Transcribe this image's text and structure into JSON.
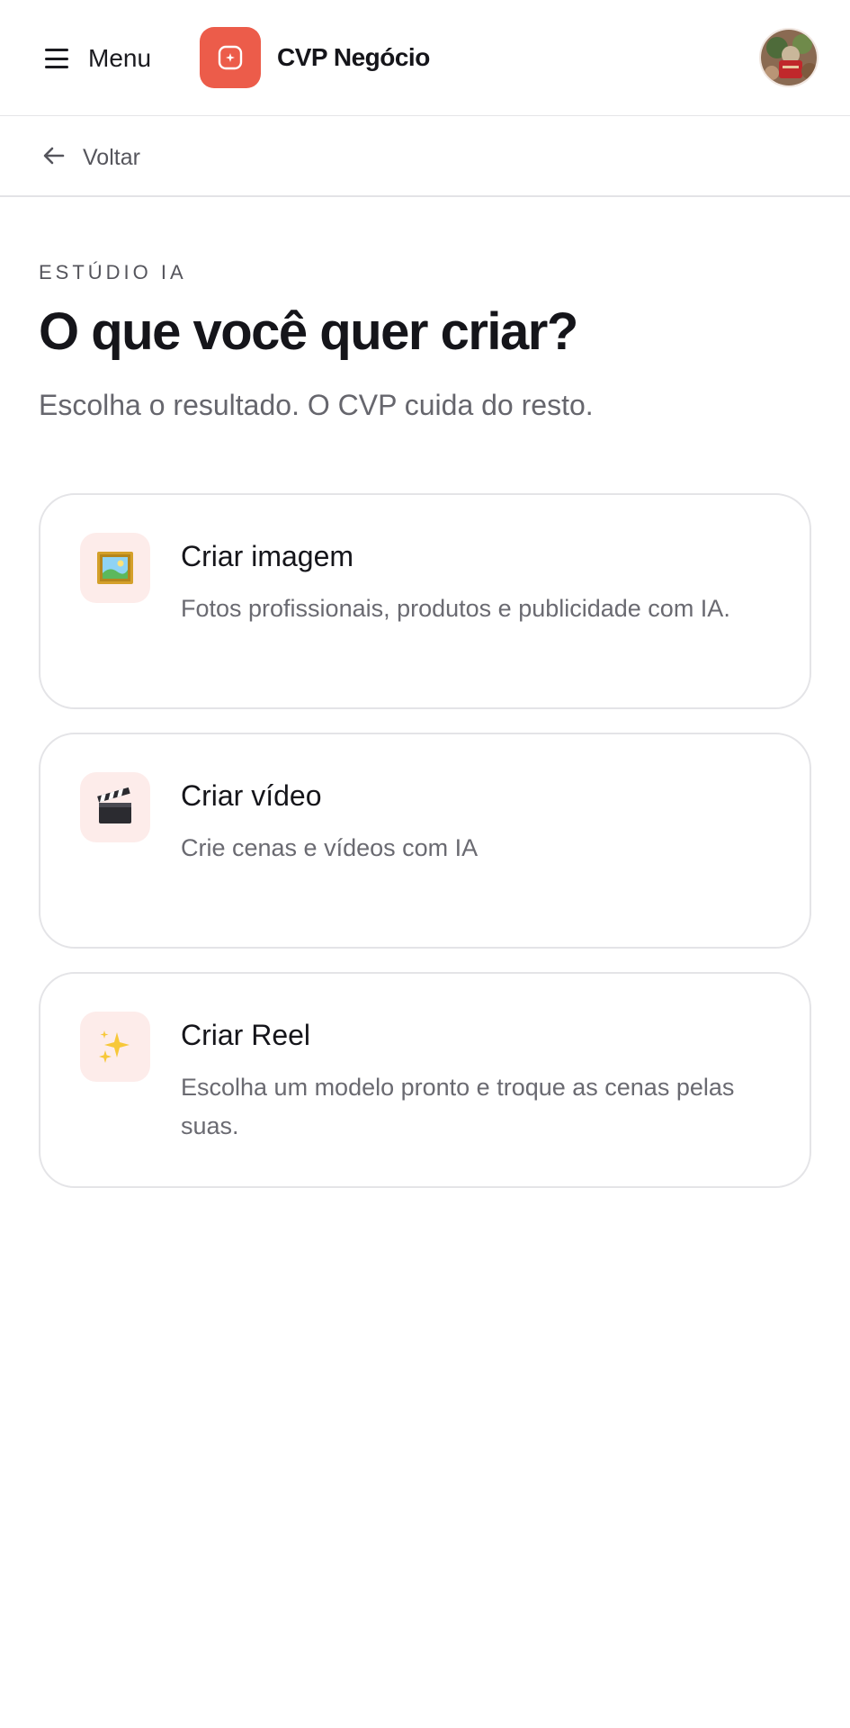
{
  "header": {
    "menu_label": "Menu",
    "brand_name": "CVP Negócio",
    "brand_color": "#ec5c4a",
    "avatar_icon": "user-avatar"
  },
  "nav": {
    "back_label": "Voltar"
  },
  "main": {
    "eyebrow": "ESTÚDIO IA",
    "title": "O que você quer criar?",
    "subtitle": "Escolha o resultado. O CVP cuida do resto.",
    "options": [
      {
        "icon": "framed-picture-icon",
        "title": "Criar imagem",
        "description": "Fotos profissionais, produtos e publicidade com IA."
      },
      {
        "icon": "clapper-board-icon",
        "title": "Criar vídeo",
        "description": "Crie cenas e vídeos com IA"
      },
      {
        "icon": "sparkles-icon",
        "title": "Criar Reel",
        "description": "Escolha um modelo pronto e troque as cenas pelas suas."
      }
    ]
  }
}
